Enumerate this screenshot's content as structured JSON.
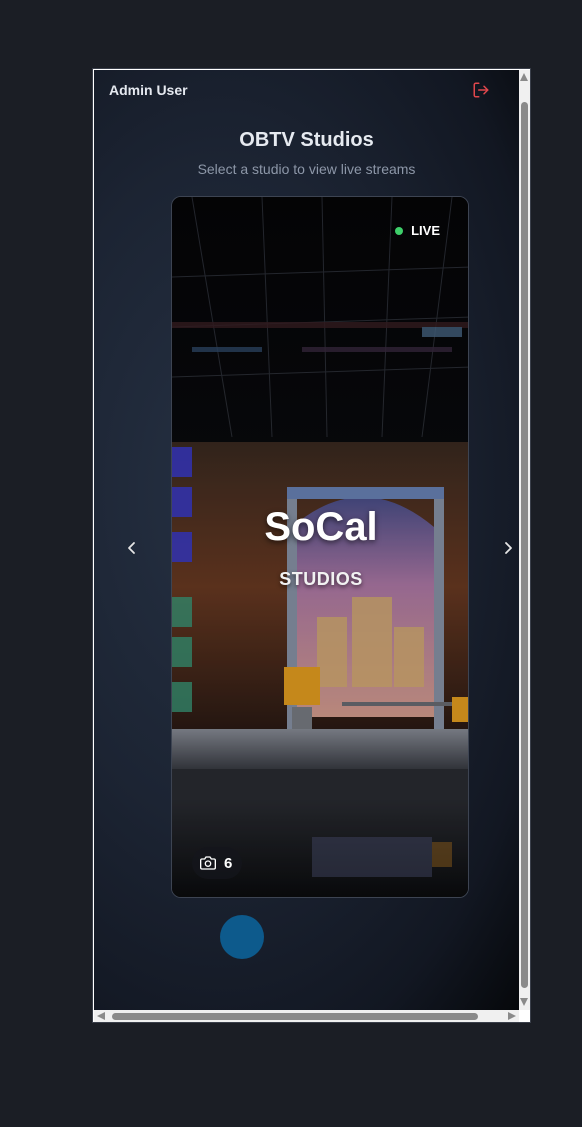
{
  "header": {
    "user_name": "Admin User",
    "logout_icon": "logout-icon",
    "logout_color": "#e0474c"
  },
  "page": {
    "title": "OBTV Studios",
    "subtitle": "Select a studio to view live streams"
  },
  "carousel": {
    "prev_icon": "chevron-left-icon",
    "next_icon": "chevron-right-icon",
    "active_index_color": "#0d5a8c",
    "card": {
      "status": "LIVE",
      "status_color": "#3ecf6a",
      "name": "SoCal",
      "subtitle": "STUDIOS",
      "camera_icon": "camera-icon",
      "camera_count": "6"
    }
  }
}
